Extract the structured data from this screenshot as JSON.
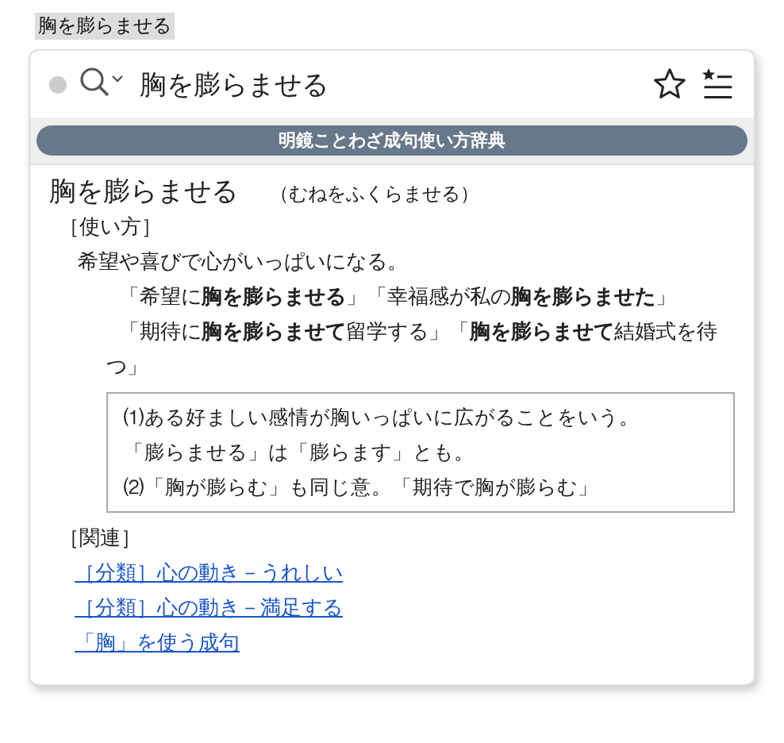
{
  "page_label": "胸を膨らませる",
  "search": {
    "value": "胸を膨らませる"
  },
  "dictionary": "明鏡ことわざ成句使い方辞典",
  "entry": {
    "headword": "胸を膨らませる",
    "reading": "（むねをふくらませる）",
    "usage_label": "［使い方］",
    "meaning": "希望や喜びで心がいっぱいになる。",
    "examples": [
      "「希望に**胸を膨らませる**」「幸福感が私の**胸を膨らませた**」",
      "「期待に**胸を膨らませて**留学する」「**胸を膨らませて**結婚式を待つ」"
    ],
    "notes": [
      "⑴ある好ましい感情が胸いっぱいに広がることをいう。",
      "「膨らませる」は「膨らます」とも。",
      "⑵「胸が膨らむ」も同じ意。「期待で胸が膨らむ」"
    ],
    "related_label": "［関連］",
    "related": [
      "［分類］心の動き－うれしい",
      "［分類］心の動き－満足する",
      "「胸」を使う成句"
    ]
  }
}
